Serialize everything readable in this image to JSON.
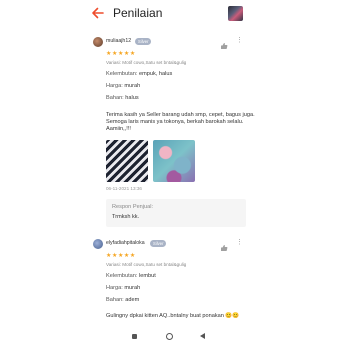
{
  "header": {
    "title": "Penilaian"
  },
  "reviews": [
    {
      "name": "muliaajh12",
      "badge": "Silver",
      "stars": "★★★★★",
      "variasi": "Variasi: Motif cowo,Satu set bntal&gulig",
      "attrs": [
        {
          "label": "Kelembutan:",
          "value": "empuk, halus"
        },
        {
          "label": "Harga:",
          "value": "murah"
        },
        {
          "label": "Bahan:",
          "value": "halus"
        }
      ],
      "text": "Terima kasih ya Seller barang udah smp, cepet, bagus juga. Semoga laris manis ya tokonya, berkah barokah selalu. Aamiin,,!!!",
      "date": "06-11-2021 13:36",
      "response": {
        "label": "Respon Penjual:",
        "text": "Trmksh kk."
      }
    },
    {
      "name": "elyfadiahpitaloka",
      "badge": "Silver",
      "stars": "★★★★★",
      "variasi": "Variasi: Motif cowo,Satu set bntal&gulig",
      "attrs": [
        {
          "label": "Kelembutan:",
          "value": "lembut"
        },
        {
          "label": "Harga:",
          "value": "murah"
        },
        {
          "label": "Bahan:",
          "value": "adem"
        }
      ],
      "text": "Gulingny dpkai kitten AQ..bntalny buat ponakan 😊😊"
    }
  ],
  "colors": {
    "accent": "#ee4d2d",
    "star": "#f5a623"
  }
}
